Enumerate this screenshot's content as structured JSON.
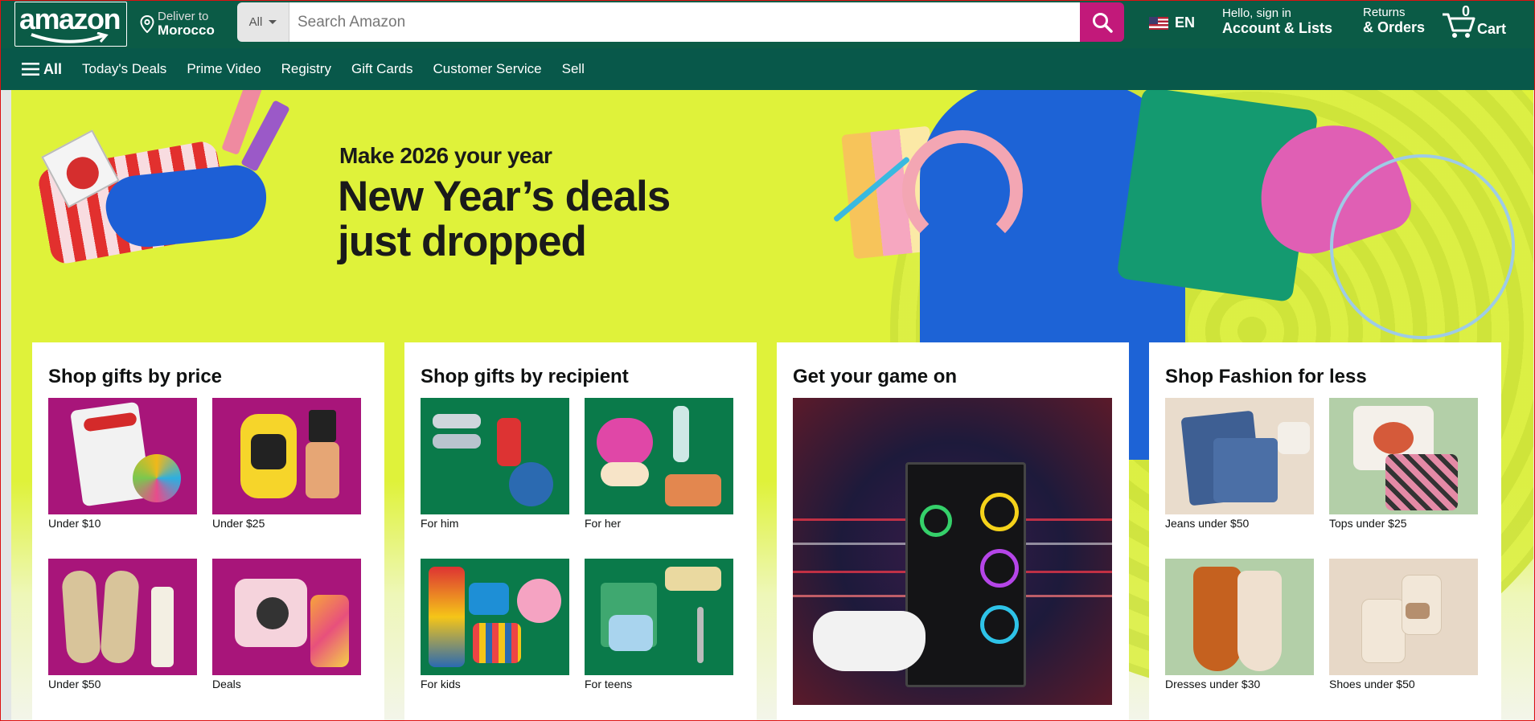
{
  "header": {
    "logo_text": "amazon",
    "deliver_line1": "Deliver to",
    "deliver_line2": "Morocco",
    "search_category": "All",
    "search_placeholder": "Search Amazon",
    "language": "EN",
    "account_line1": "Hello, sign in",
    "account_line2": "Account & Lists",
    "returns_line1": "Returns",
    "returns_line2": "& Orders",
    "cart_count": "0",
    "cart_label": "Cart"
  },
  "subnav": {
    "all": "All",
    "links": [
      "Today's Deals",
      "Prime Video",
      "Registry",
      "Gift Cards",
      "Customer Service",
      "Sell"
    ]
  },
  "hero": {
    "tagline": "Make 2026 your year",
    "headline_line1": "New Year’s deals",
    "headline_line2": "just dropped"
  },
  "cards": [
    {
      "title": "Shop gifts by price",
      "items": [
        "Under $10",
        "Under $25",
        "Under $50",
        "Deals"
      ]
    },
    {
      "title": "Shop gifts by recipient",
      "items": [
        "For him",
        "For her",
        "For kids",
        "For teens"
      ]
    },
    {
      "title": "Get your game on"
    },
    {
      "title": "Shop Fashion for less",
      "items": [
        "Jeans under $50",
        "Tops under $25",
        "Dresses under $30",
        "Shoes under $50"
      ]
    }
  ],
  "colors": {
    "nav_bg": "#0b5b46",
    "search_button": "#c2197a",
    "hero_bg": "#dff23a"
  }
}
